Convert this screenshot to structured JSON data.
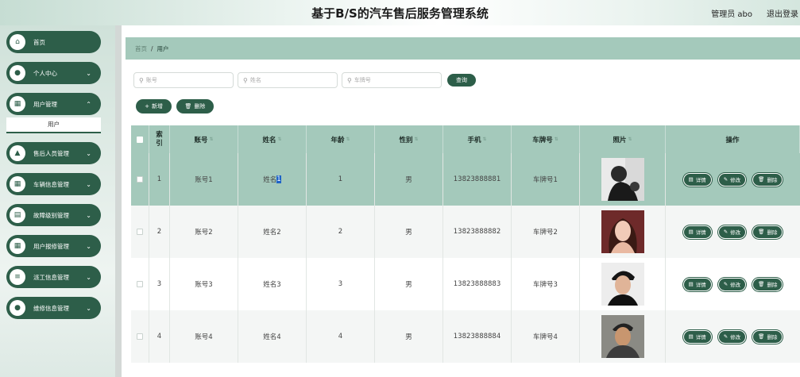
{
  "header": {
    "title": "基于B/S的汽车售后服务管理系统",
    "admin": "管理员 abo",
    "logout": "退出登录"
  },
  "sidebar": {
    "items": [
      {
        "label": "首页",
        "icon": "home-icon",
        "has_chevron": false
      },
      {
        "label": "个人中心",
        "icon": "person-icon",
        "has_chevron": true
      },
      {
        "label": "用户管理",
        "icon": "grid-icon",
        "has_chevron": true
      },
      {
        "label": "售后人员管理",
        "icon": "tent-icon",
        "has_chevron": true
      },
      {
        "label": "车辆信息管理",
        "icon": "grid-icon",
        "has_chevron": true
      },
      {
        "label": "故障级别管理",
        "icon": "chart-icon",
        "has_chevron": true
      },
      {
        "label": "用户报修管理",
        "icon": "grid-icon",
        "has_chevron": true
      },
      {
        "label": "派工信息管理",
        "icon": "list-icon",
        "has_chevron": true
      },
      {
        "label": "维修信息管理",
        "icon": "person-icon",
        "has_chevron": true
      }
    ],
    "submenu_label": "用户",
    "chevron": "⌄"
  },
  "breadcrumb": {
    "home": "首页",
    "sep": "/",
    "current": "用户"
  },
  "search": {
    "account_placeholder": "账号",
    "name_placeholder": "姓名",
    "plate_placeholder": "车牌号",
    "search_button": "查询"
  },
  "toolbar": {
    "add_label": "新增",
    "delete_label": "删除"
  },
  "table": {
    "headers": {
      "index": "索引",
      "account": "账号",
      "name": "姓名",
      "age": "年龄",
      "gender": "性别",
      "phone": "手机",
      "plate": "车牌号",
      "photo": "照片",
      "ops": "操作"
    },
    "rows": [
      {
        "index": "1",
        "account": "账号1",
        "name": "姓名",
        "name_highlight": "1",
        "age": "1",
        "gender": "男",
        "phone": "13823888881",
        "plate": "车牌号1"
      },
      {
        "index": "2",
        "account": "账号2",
        "name": "姓名2",
        "name_highlight": "",
        "age": "2",
        "gender": "男",
        "phone": "13823888882",
        "plate": "车牌号2"
      },
      {
        "index": "3",
        "account": "账号3",
        "name": "姓名3",
        "name_highlight": "",
        "age": "3",
        "gender": "男",
        "phone": "13823888883",
        "plate": "车牌号3"
      },
      {
        "index": "4",
        "account": "账号4",
        "name": "姓名4",
        "name_highlight": "",
        "age": "4",
        "gender": "男",
        "phone": "13823888884",
        "plate": "车牌号4"
      }
    ],
    "actions": {
      "detail": "详情",
      "edit": "修改",
      "delete": "删除"
    }
  },
  "colors": {
    "accent": "#2d5e49",
    "header_bg": "#a4c9bb",
    "highlight": "#1e63c7"
  }
}
